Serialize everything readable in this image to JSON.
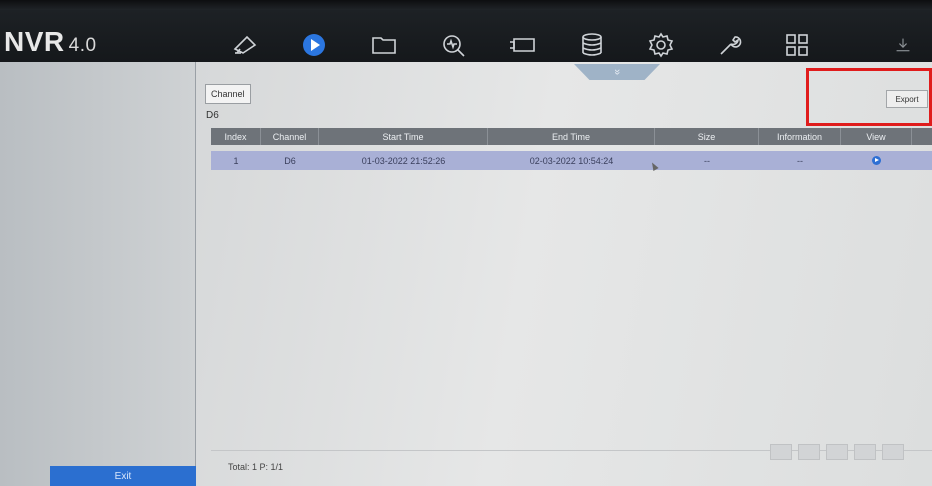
{
  "brand": {
    "logo": "NVR",
    "version": "4.0"
  },
  "menu": [
    {
      "icon": "live-view-camera-icon",
      "active": false
    },
    {
      "icon": "playback-icon",
      "active": true
    },
    {
      "icon": "file-management-icon",
      "active": false
    },
    {
      "icon": "search-icon",
      "active": false
    },
    {
      "icon": "camera-icon",
      "active": false
    },
    {
      "icon": "storage-icon",
      "active": false
    },
    {
      "icon": "gear-icon",
      "active": false
    },
    {
      "icon": "maintenance-wrench-icon",
      "active": false
    },
    {
      "icon": "grid-icon",
      "active": false
    },
    {
      "icon": "download-icon",
      "active": false
    }
  ],
  "sidebar": {
    "exit_label": "Exit"
  },
  "main": {
    "collapse_glyph": "»",
    "channel_button": "Channel",
    "channel_value": "D6",
    "export_button": "Export",
    "columns": [
      "Index",
      "Channel",
      "Start Time",
      "End Time",
      "Size",
      "Information",
      "View"
    ],
    "rows": [
      {
        "index": "1",
        "channel": "D6",
        "start_time": "01-03-2022 21:52:26",
        "end_time": "02-03-2022 10:54:24",
        "size": "--",
        "information": "--"
      }
    ],
    "total_text": "Total: 1  P: 1/1"
  },
  "colors": {
    "accent": "#2b6fd0",
    "highlight": "#e01c1c",
    "row_selected": "#a9b0d6",
    "header_bg": "#6e7379"
  }
}
